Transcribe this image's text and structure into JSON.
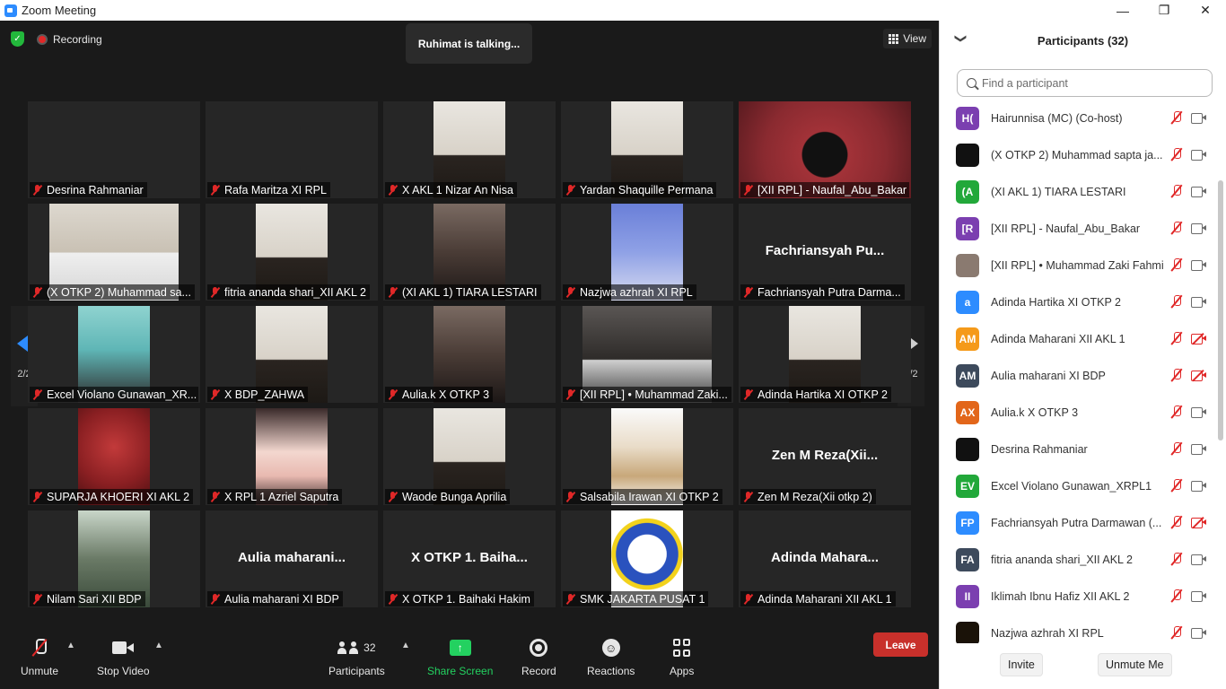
{
  "window": {
    "title": "Zoom Meeting",
    "controls": [
      "—",
      "❐",
      "✕"
    ]
  },
  "meeting": {
    "recording_label": "Recording",
    "talking_indicator": "Ruhimat is talking...",
    "view_label": "View",
    "page_indicator_left": "2/2",
    "page_indicator_right": "2/2",
    "tiles": [
      {
        "label": "Desrina Rahmaniar",
        "center": "",
        "video": "none"
      },
      {
        "label": "Rafa Maritza XI RPL",
        "center": "",
        "video": "none"
      },
      {
        "label": "X AKL 1 Nizar An Nisa",
        "center": "",
        "video": "light"
      },
      {
        "label": "Yardan Shaquille Permana",
        "center": "",
        "video": "light"
      },
      {
        "label": "[XII RPL] - Naufal_Abu_Bakar",
        "center": "",
        "video": "red-wide"
      },
      {
        "label": "(X OTKP 2) Muhammad sa...",
        "center": "",
        "video": "light-wide"
      },
      {
        "label": "fitria ananda shari_XII AKL 2",
        "center": "",
        "video": "light"
      },
      {
        "label": "(XI AKL 1) TIARA LESTARI",
        "center": "",
        "video": "mid"
      },
      {
        "label": "Nazjwa azhrah XI RPL",
        "center": "",
        "video": "blue"
      },
      {
        "label": "Fachriansyah Putra Darma...",
        "center": "Fachriansyah  Pu...",
        "video": "none"
      },
      {
        "label": "Excel Violano Gunawan_XR...",
        "center": "",
        "video": "teal"
      },
      {
        "label": "X BDP_ZAHWA",
        "center": "",
        "video": "light"
      },
      {
        "label": "Aulia.k X OTKP 3",
        "center": "",
        "video": "mid"
      },
      {
        "label": "[XII RPL] • Muhammad Zaki...",
        "center": "",
        "video": "mid-wide"
      },
      {
        "label": "Adinda Hartika XI OTKP 2",
        "center": "",
        "video": "light"
      },
      {
        "label": "SUPARJA KHOERI XI AKL 2",
        "center": "",
        "video": "red"
      },
      {
        "label": "X RPL 1 Azriel Saputra",
        "center": "",
        "video": "anime"
      },
      {
        "label": "Waode Bunga Aprilia",
        "center": "",
        "video": "light"
      },
      {
        "label": "Salsabila Irawan XI OTKP 2",
        "center": "",
        "video": "sketch"
      },
      {
        "label": "Zen M Reza(Xii otkp 2)",
        "center": "Zen M Reza(Xii...",
        "video": "none"
      },
      {
        "label": "Nilam Sari XII BDP",
        "center": "",
        "video": "green"
      },
      {
        "label": "Aulia maharani XI BDP",
        "center": "Aulia  maharani...",
        "video": "none"
      },
      {
        "label": "X OTKP 1. Baihaki Hakim",
        "center": "X OTKP 1. Baiha...",
        "video": "none"
      },
      {
        "label": "SMK JAKARTA PUSAT 1",
        "center": "",
        "video": "logo"
      },
      {
        "label": "Adinda Maharani XII AKL 1",
        "center": "Adinda  Mahara...",
        "video": "none"
      }
    ]
  },
  "toolbar": {
    "unmute": "Unmute",
    "stop_video": "Stop Video",
    "participants": "Participants",
    "participants_count": "32",
    "share_screen": "Share Screen",
    "record": "Record",
    "reactions": "Reactions",
    "apps": "Apps",
    "leave": "Leave"
  },
  "panel": {
    "title": "Participants (32)",
    "search_placeholder": "Find a participant",
    "participants": [
      {
        "initials": "H(",
        "color": "#7b3fb0",
        "name": "Hairunnisa (MC) (Co-host)",
        "cam_off": false
      },
      {
        "initials": "",
        "color": "#111111",
        "name": "(X OTKP 2) Muhammad sapta ja...",
        "cam_off": false
      },
      {
        "initials": "(A",
        "color": "#22a83a",
        "name": "(XI AKL 1) TIARA LESTARI",
        "cam_off": false
      },
      {
        "initials": "[R",
        "color": "#7b3fb0",
        "name": "[XII RPL] - Naufal_Abu_Bakar",
        "cam_off": false
      },
      {
        "initials": "",
        "color": "#8a7a70",
        "name": "[XII RPL] • Muhammad Zaki Fahmi",
        "cam_off": false
      },
      {
        "initials": "a",
        "color": "#2d8cff",
        "name": "Adinda Hartika XI OTKP 2",
        "cam_off": false
      },
      {
        "initials": "AM",
        "color": "#f59a1a",
        "name": "Adinda Maharani XII AKL 1",
        "cam_off": true
      },
      {
        "initials": "AM",
        "color": "#3d4a5c",
        "name": "Aulia maharani XI BDP",
        "cam_off": true
      },
      {
        "initials": "AX",
        "color": "#e2661a",
        "name": "Aulia.k X OTKP 3",
        "cam_off": false
      },
      {
        "initials": "",
        "color": "#111111",
        "name": "Desrina Rahmaniar",
        "cam_off": false
      },
      {
        "initials": "EV",
        "color": "#22a83a",
        "name": "Excel Violano Gunawan_XRPL1",
        "cam_off": false
      },
      {
        "initials": "FP",
        "color": "#2d8cff",
        "name": "Fachriansyah Putra Darmawan (...",
        "cam_off": true
      },
      {
        "initials": "FA",
        "color": "#3d4a5c",
        "name": "fitria ananda shari_XII AKL 2",
        "cam_off": false
      },
      {
        "initials": "II",
        "color": "#7b3fb0",
        "name": "Iklimah Ibnu Hafiz XII AKL 2",
        "cam_off": false
      },
      {
        "initials": "",
        "color": "#1a1208",
        "name": "Nazjwa azhrah XI RPL",
        "cam_off": false
      }
    ],
    "invite": "Invite",
    "unmute_me": "Unmute Me"
  }
}
